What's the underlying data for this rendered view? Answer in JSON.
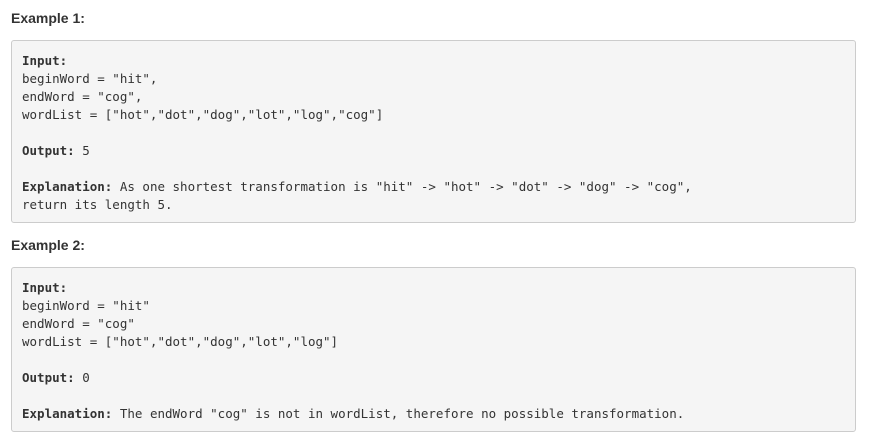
{
  "examples": [
    {
      "heading": "Example 1:",
      "input_label": "Input:",
      "input_lines": [
        "beginWord = \"hit\",",
        "endWord = \"cog\",",
        "wordList = [\"hot\",\"dot\",\"dog\",\"lot\",\"log\",\"cog\"]"
      ],
      "output_label": "Output:",
      "output_value": " 5",
      "explanation_label": "Explanation:",
      "explanation_lines": [
        " As one shortest transformation is \"hit\" -> \"hot\" -> \"dot\" -> \"dog\" -> \"cog\",",
        "return its length 5."
      ]
    },
    {
      "heading": "Example 2:",
      "input_label": "Input:",
      "input_lines": [
        "beginWord = \"hit\"",
        "endWord = \"cog\"",
        "wordList = [\"hot\",\"dot\",\"dog\",\"lot\",\"log\"]"
      ],
      "output_label": "Output:",
      "output_value": " 0",
      "explanation_label": "Explanation:",
      "explanation_lines": [
        " The endWord \"cog\" is not in wordList, therefore no possible transformation."
      ]
    }
  ]
}
